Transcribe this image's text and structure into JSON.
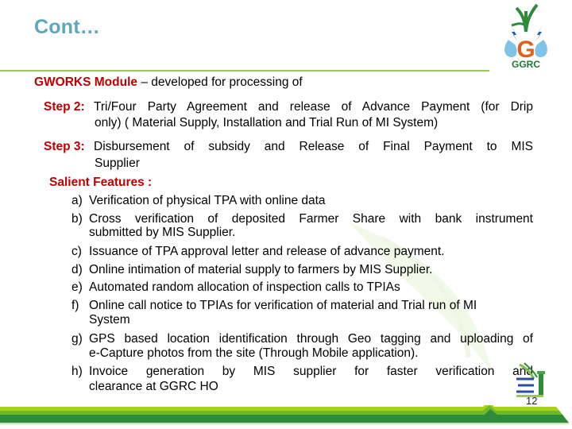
{
  "slide": {
    "title": "Cont…",
    "page_number": "12",
    "logo_text": "GGRC",
    "logo_letter": "G"
  },
  "intro": {
    "module_label": "GWORKS Module",
    "rest": " – developed for processing of"
  },
  "steps": [
    {
      "label": "Step 2:",
      "line1": "Tri/Four Party Agreement  and release of Advance Payment (for Drip",
      "line2": "only) ( Material Supply, Installation and Trial Run of MI System)"
    },
    {
      "label": "Step 3:",
      "line1": "Disbursement  of  subsidy  and  Release of  Final Payment  to MIS",
      "line2": "Supplier"
    }
  ],
  "features": {
    "heading": "Salient Features :",
    "items": [
      {
        "marker": "a)",
        "line1": "Verification of physical TPA with online data",
        "line2": ""
      },
      {
        "marker": "b)",
        "line1": "Cross verification of deposited Farmer Share with bank instrument",
        "line2": "submitted by MIS Supplier."
      },
      {
        "marker": "c)",
        "line1": "Issuance of TPA approval letter and release of advance payment.",
        "line2": ""
      },
      {
        "marker": "d)",
        "line1": "Online intimation of material supply to farmers by MIS Supplier.",
        "line2": ""
      },
      {
        "marker": "e)",
        "line1": "Automated random allocation of inspection calls to TPIAs",
        "line2": ""
      },
      {
        "marker": "f)",
        "line1": "Online call notice to TPIAs for verification of material and Trial run of MI",
        "line2": "System"
      },
      {
        "marker": "g)",
        "line1": "GPS based location identification through Geo tagging and uploading of",
        "line2": "e-Capture photos from the site (Through Mobile application)."
      },
      {
        "marker": "h)",
        "line1": "Invoice generation by MIS supplier for faster verification and",
        "line2": "clearance at GGRC HO"
      }
    ]
  },
  "colors": {
    "title": "#5ea6c0",
    "accent_red": "#c00000",
    "rule_green": "#9bc75b"
  }
}
